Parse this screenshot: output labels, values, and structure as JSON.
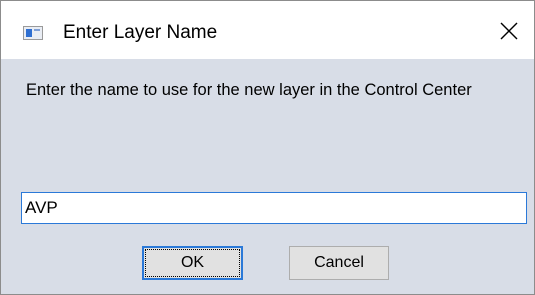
{
  "window": {
    "title": "Enter Layer Name",
    "icon": "app-window-icon",
    "close_icon": "close-icon"
  },
  "dialog": {
    "prompt": "Enter the name to use for the new layer in the Control Center",
    "input_value": "AVP",
    "ok_label": "OK",
    "cancel_label": "Cancel"
  },
  "colors": {
    "dialog_background": "#d8dde7",
    "focus_accent": "#2b79d8",
    "button_face": "#e1e1e1"
  }
}
